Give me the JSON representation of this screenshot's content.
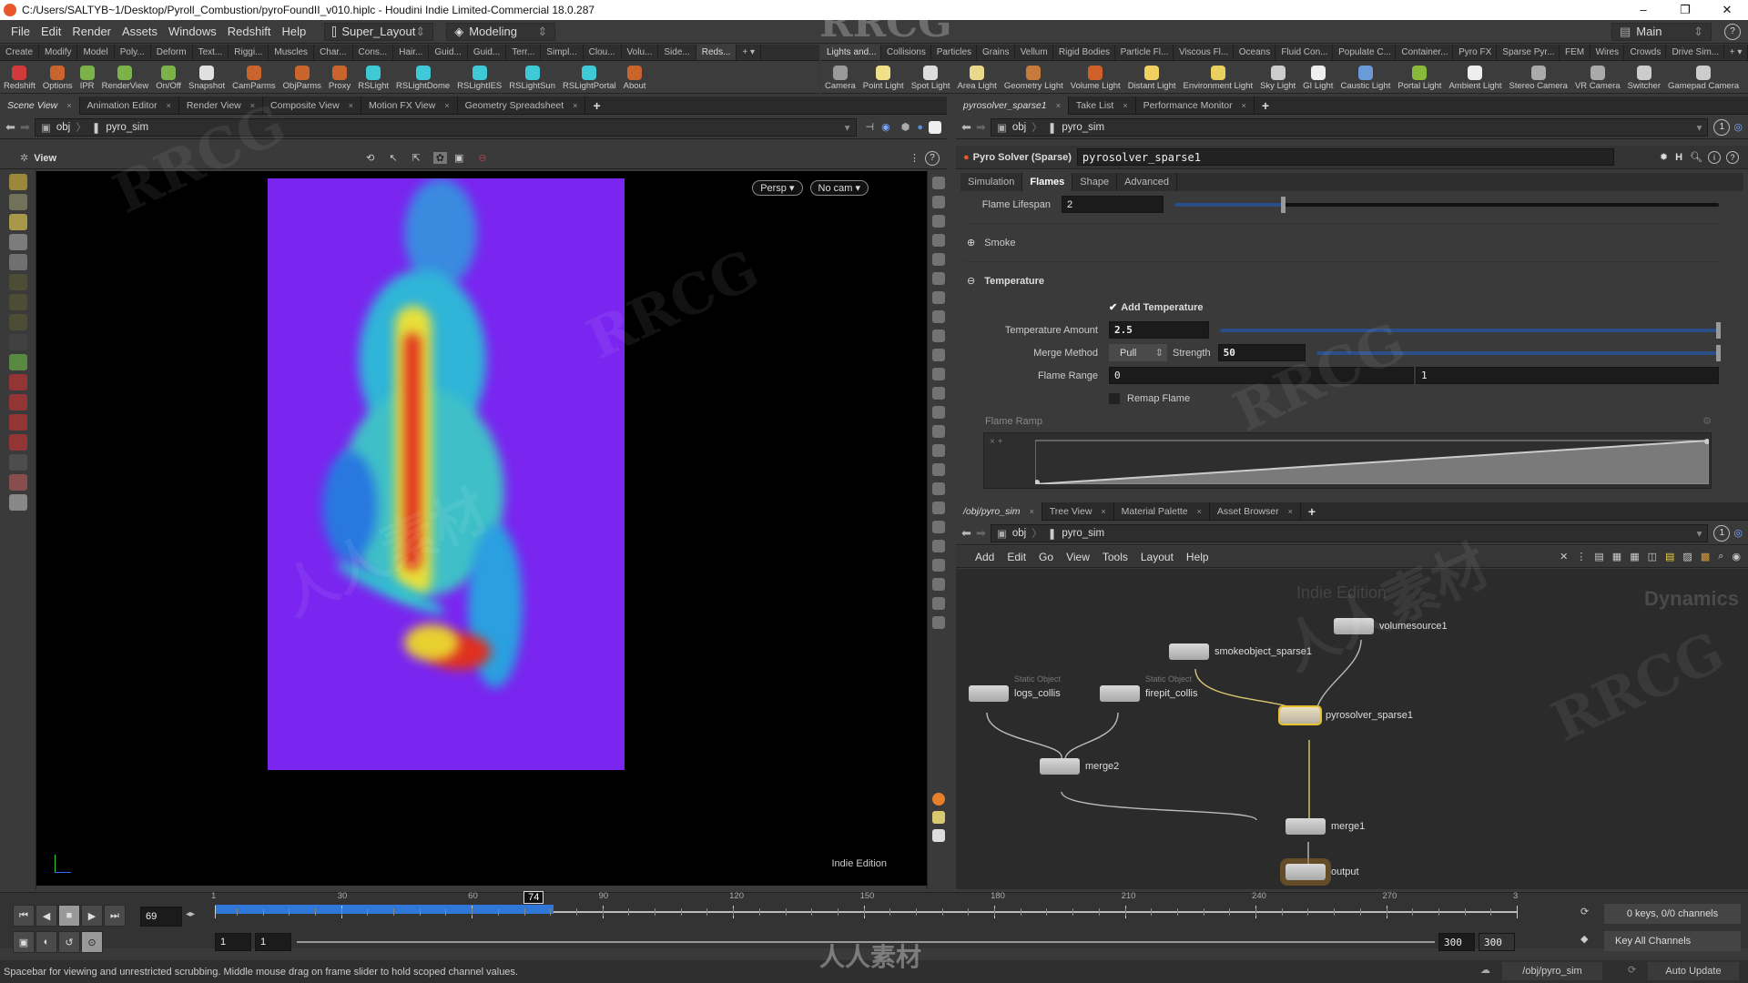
{
  "window": {
    "title": "C:/Users/SALTYB~1/Desktop/Pyroll_Combustion/pyroFoundII_v010.hiplc - Houdini Indie Limited-Commercial 18.0.287",
    "controls": [
      "–",
      "❐",
      "✕"
    ]
  },
  "menu": {
    "items": [
      "File",
      "Edit",
      "Render",
      "Assets",
      "Windows",
      "Redshift",
      "Help"
    ],
    "desktop": "Super_Layout",
    "context": "Modeling",
    "right_desktop": "Main",
    "help_icon": "?"
  },
  "shelf_left": {
    "tabs": [
      "Create",
      "Modify",
      "Model",
      "Poly...",
      "Deform",
      "Text...",
      "Riggi...",
      "Muscles",
      "Char...",
      "Cons...",
      "Hair...",
      "Guid...",
      "Guid...",
      "Terr...",
      "Simpl...",
      "Clou...",
      "Volu...",
      "Side...",
      "Reds..."
    ],
    "active_tab": "Reds...",
    "tools": [
      {
        "label": "Redshift",
        "color": "#d23a3a"
      },
      {
        "label": "Options",
        "color": "#c8642c"
      },
      {
        "label": "IPR",
        "color": "#7bb24a"
      },
      {
        "label": "RenderView",
        "color": "#7bb24a"
      },
      {
        "label": "On/Off",
        "color": "#7bb24a"
      },
      {
        "label": "Snapshot",
        "color": "#e0e0e0"
      },
      {
        "label": "CamParms",
        "color": "#c8642c"
      },
      {
        "label": "ObjParms",
        "color": "#c8642c"
      },
      {
        "label": "Proxy",
        "color": "#c8642c"
      },
      {
        "label": "RSLight",
        "color": "#3fc8d6"
      },
      {
        "label": "RSLightDome",
        "color": "#3fc8d6"
      },
      {
        "label": "RSLightIES",
        "color": "#3fc8d6"
      },
      {
        "label": "RSLightSun",
        "color": "#3fc8d6"
      },
      {
        "label": "RSLightPortal",
        "color": "#3fc8d6"
      },
      {
        "label": "About",
        "color": "#c8642c"
      }
    ]
  },
  "shelf_right": {
    "tabs": [
      "Lights and...",
      "Collisions",
      "Particles",
      "Grains",
      "Vellum",
      "Rigid Bodies",
      "Particle Fl...",
      "Viscous Fl...",
      "Oceans",
      "Fluid Con...",
      "Populate C...",
      "Container...",
      "Pyro FX",
      "Sparse Pyr...",
      "FEM",
      "Wires",
      "Crowds",
      "Drive Sim..."
    ],
    "active_tab": "Lights and...",
    "tools": [
      {
        "label": "Camera",
        "color": "#999"
      },
      {
        "label": "Point Light",
        "color": "#f0e08a"
      },
      {
        "label": "Spot Light",
        "color": "#ddd"
      },
      {
        "label": "Area Light",
        "color": "#e8d88a"
      },
      {
        "label": "Geometry Light",
        "color": "#c87a3a"
      },
      {
        "label": "Volume Light",
        "color": "#d0602a"
      },
      {
        "label": "Distant Light",
        "color": "#f0d060"
      },
      {
        "label": "Environment Light",
        "color": "#e8d060"
      },
      {
        "label": "Sky Light",
        "color": "#ccc"
      },
      {
        "label": "GI Light",
        "color": "#eee"
      },
      {
        "label": "Caustic Light",
        "color": "#6a9ad8"
      },
      {
        "label": "Portal Light",
        "color": "#8ab83a"
      },
      {
        "label": "Ambient Light",
        "color": "#eee"
      },
      {
        "label": "Stereo Camera",
        "color": "#aaa"
      },
      {
        "label": "VR Camera",
        "color": "#aaa"
      },
      {
        "label": "Switcher",
        "color": "#ccc"
      },
      {
        "label": "Gamepad Camera",
        "color": "#ccc"
      }
    ]
  },
  "scene_view": {
    "tabs": [
      "Scene View",
      "Animation Editor",
      "Render View",
      "Composite View",
      "Motion FX View",
      "Geometry Spreadsheet"
    ],
    "path": [
      "obj",
      "pyro_sim"
    ],
    "view_label": "View",
    "camera_menu": "Persp ▾",
    "cam_menu": "No cam ▾",
    "edition_label": "Indie Edition"
  },
  "params_pane": {
    "tabs": [
      "pyrosolver_sparse1",
      "Take List",
      "Performance Monitor"
    ],
    "path": [
      "obj",
      "pyro_sim"
    ],
    "node_type": "Pyro Solver (Sparse)",
    "node_name": "pyrosolver_sparse1",
    "param_tabs": [
      "Simulation",
      "Flames",
      "Shape",
      "Advanced"
    ],
    "active_param_tab": "Flames",
    "flame_lifespan": {
      "label": "Flame Lifespan",
      "value": "2",
      "slider_fraction": 0.2
    },
    "smoke_section": "Smoke",
    "temperature_section": "Temperature",
    "add_temperature": {
      "label": "Add Temperature",
      "checked": true
    },
    "temperature_amount": {
      "label": "Temperature Amount",
      "value": "2.5",
      "slider_fraction": 1.0
    },
    "merge_method": {
      "label": "Merge Method",
      "value": "Pull"
    },
    "strength": {
      "label": "Strength",
      "value": "50",
      "slider_fraction": 1.0
    },
    "flame_range": {
      "label": "Flame Range",
      "min": "0",
      "max": "1"
    },
    "remap_flame": {
      "label": "Remap Flame",
      "checked": false
    },
    "flame_ramp": {
      "label": "Flame Ramp",
      "start": 0.0,
      "end": 1.0
    }
  },
  "network_pane": {
    "tabs": [
      "/obj/pyro_sim",
      "Tree View",
      "Material Palette",
      "Asset Browser"
    ],
    "path": [
      "obj",
      "pyro_sim"
    ],
    "menu": [
      "Add",
      "Edit",
      "Go",
      "View",
      "Tools",
      "Layout",
      "Help"
    ],
    "watermark_edition": "Indie Edition",
    "context_label": "Dynamics",
    "nodes": [
      {
        "name": "volumesource1",
        "sub": ""
      },
      {
        "name": "smokeobject_sparse1",
        "sub": ""
      },
      {
        "name": "logs_collis",
        "sub": "Static Object"
      },
      {
        "name": "firepit_collis",
        "sub": "Static Object"
      },
      {
        "name": "pyrosolver_sparse1",
        "sub": ""
      },
      {
        "name": "merge2",
        "sub": ""
      },
      {
        "name": "merge1",
        "sub": ""
      },
      {
        "name": "output",
        "sub": ""
      }
    ]
  },
  "timeline": {
    "current_frame": "69",
    "scrub_frame": "74",
    "ticks": [
      "1",
      "30",
      "60",
      "90",
      "120",
      "150",
      "180",
      "210",
      "240",
      "270",
      "3"
    ],
    "cached_fraction": 0.26,
    "start": "1",
    "start2": "1",
    "end": "300",
    "end2": "300",
    "keys_label": "0 keys, 0/0 channels",
    "key_all": "Key All Channels"
  },
  "status": {
    "message": "Spacebar for viewing and unrestricted scrubbing. Middle mouse drag on frame slider to hold scoped channel values.",
    "path": "/obj/pyro_sim",
    "update_mode": "Auto Update"
  },
  "watermarks": [
    "RRCG",
    "人人素材"
  ]
}
